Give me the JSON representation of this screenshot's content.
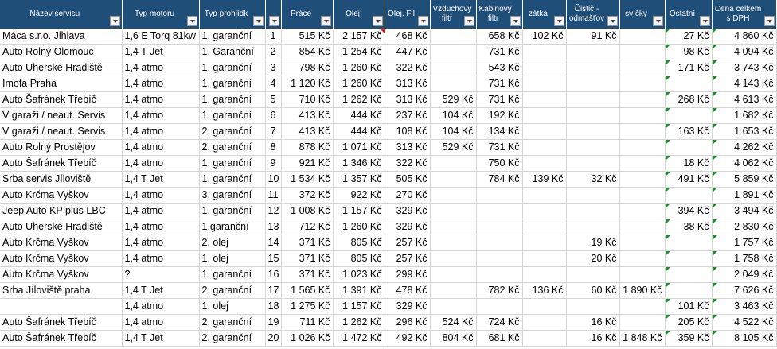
{
  "headers": [
    "Název servisu",
    "Typ motoru",
    "Typ prohlídk",
    "",
    "Práce",
    "Olej",
    "Olej. Fil",
    "Vzduchový filtr",
    "Kabinový filtr",
    "zátka",
    "Čistič - odmašťov",
    "svíčky",
    "Ostatní",
    "Cena celkem s DPH",
    ""
  ],
  "rows": [
    [
      "Máca s.r.o. Jihlava",
      "1,6 E Torq 81kw",
      "1. garanční",
      "1",
      "515 Kč",
      "2 157 Kč",
      "468 Kč",
      "",
      "658 Kč",
      "102 Kč",
      "91 Kč",
      "",
      "27 Kč",
      "4 860 Kč",
      ""
    ],
    [
      "Auto Rolný Olomouc",
      "1,4 T Jet",
      "1. Garanční",
      "2",
      "854 Kč",
      "1 254 Kč",
      "447 Kč",
      "",
      "731 Kč",
      "",
      "",
      "",
      "98 Kč",
      "4 094 Kč",
      ""
    ],
    [
      "Auto Uherské Hradiště",
      "1,4 atmo",
      "1. garanční",
      "3",
      "798 Kč",
      "1 260 Kč",
      "322 Kč",
      "",
      "543 Kč",
      "",
      "",
      "",
      "171 Kč",
      "3 743 Kč",
      ""
    ],
    [
      "Imofa Praha",
      "1,4 atmo",
      "1. garanční",
      "4",
      "1 120 Kč",
      "1 260 Kč",
      "313 Kč",
      "",
      "731 Kč",
      "",
      "",
      "",
      "",
      "4 143 Kč",
      ""
    ],
    [
      "Auto Šafránek Třebíč",
      "1,4 atmo",
      "1. garanční",
      "5",
      "710 Kč",
      "1 262 Kč",
      "313 Kč",
      "529 Kč",
      "731 Kč",
      "",
      "",
      "",
      "268 Kč",
      "4 613 Kč",
      ""
    ],
    [
      "V garaži / neaut. Servis",
      "1,4 atmo",
      "1. garanční",
      "6",
      "413 Kč",
      "444 Kč",
      "237 Kč",
      "104 Kč",
      "192 Kč",
      "",
      "",
      "",
      "",
      "1 682 Kč",
      ""
    ],
    [
      "V garaži / neaut. Servis",
      "1,4 atmo",
      "2. garanční",
      "7",
      "413 Kč",
      "444 Kč",
      "108 Kč",
      "104 Kč",
      "134 Kč",
      "",
      "",
      "",
      "163 Kč",
      "1 653 Kč",
      ""
    ],
    [
      "Auto Rolný Prostějov",
      "1,4 atmo",
      "2. garanční",
      "8",
      "878 Kč",
      "1 071 Kč",
      "313 Kč",
      "529 Kč",
      "731 Kč",
      "",
      "",
      "",
      "",
      "4 262 Kč",
      ""
    ],
    [
      "Auto Šafránek Třebíč",
      "1,4 atmo",
      "1. garanční",
      "9",
      "921 Kč",
      "1 346 Kč",
      "322 Kč",
      "",
      "750 Kč",
      "",
      "",
      "",
      "18 Kč",
      "4 062 Kč",
      ""
    ],
    [
      "Srba servis Jíloviště",
      "1,4 T Jet",
      "1. garanční",
      "10",
      "1 534 Kč",
      "1 357 Kč",
      "505 Kč",
      "",
      "784 Kč",
      "139 Kč",
      "32 Kč",
      "",
      "491 Kč",
      "5 859 Kč",
      ""
    ],
    [
      "Auto Krčma Vyškov",
      "1,4 atmo",
      "3. garanční",
      "11",
      "372 Kč",
      "922 Kč",
      "270 Kč",
      "",
      "",
      "",
      "",
      "",
      "",
      "1 891 Kč",
      ""
    ],
    [
      "Jeep Auto KP plus LBC",
      "1,4 atmo",
      "1. garanční",
      "12",
      "1 008 Kč",
      "1 157 Kč",
      "329 Kč",
      "",
      "",
      "",
      "",
      "",
      "394 Kč",
      "3 494 Kč",
      ""
    ],
    [
      "Auto Uherské Hradiště",
      "1,4 atmo",
      "1.garanční",
      "13",
      "712 Kč",
      "1 260 Kč",
      "329 Kč",
      "",
      "",
      "",
      "",
      "",
      "38 Kč",
      "2 830 Kč",
      ""
    ],
    [
      "Auto Krčma Vyškov",
      "1,4 atmo",
      "2. olej",
      "14",
      "371 Kč",
      "805 Kč",
      "257 Kč",
      "",
      "",
      "",
      "19 Kč",
      "",
      "",
      "1 757 Kč",
      ""
    ],
    [
      "Auto Krčma Vyškov",
      "1,4 atmo",
      "1. olej",
      "15",
      "371 Kč",
      "805 Kč",
      "257 Kč",
      "",
      "",
      "",
      "20 Kč",
      "",
      "",
      "1 758 Kč",
      ""
    ],
    [
      "Auto Krčma Vyškov",
      "?",
      "1. garanční",
      "16",
      "371 Kč",
      "1 023 Kč",
      "299 Kč",
      "",
      "",
      "",
      "",
      "",
      "",
      "2 049 Kč",
      ""
    ],
    [
      "Srba Jíloviště praha",
      "1,4 T Jet",
      "2. garanční",
      "17",
      "1 565 Kč",
      "1 391 Kč",
      "478 Kč",
      "",
      "782 Kč",
      "136 Kč",
      "60 Kč",
      "1 890 Kč",
      "",
      "7 626 Kč",
      ""
    ],
    [
      "",
      "1,4 atmo",
      "1. olej",
      "18",
      "1 275 Kč",
      "1 157 Kč",
      "329 Kč",
      "",
      "",
      "",
      "",
      "",
      "101 Kč",
      "3 463 Kč",
      ""
    ],
    [
      "Auto Šafránek Třebíč",
      "1,4 atmo",
      "2. garanční",
      "19",
      "711 Kč",
      "1 262 Kč",
      "296 Kč",
      "524 Kč",
      "724 Kč",
      "",
      "16 Kč",
      "",
      "205 Kč",
      "4 522 Kč",
      ""
    ],
    [
      "Auto Šafránek Třebíč",
      "1,4 T Jet",
      "2. garanční",
      "20",
      "1 026 Kč",
      "1 472 Kč",
      "492 Kč",
      "804 Kč",
      "681 Kč",
      "",
      "16 Kč",
      "1 848 Kč",
      "359 Kč",
      "8 105 Kč",
      ""
    ]
  ]
}
